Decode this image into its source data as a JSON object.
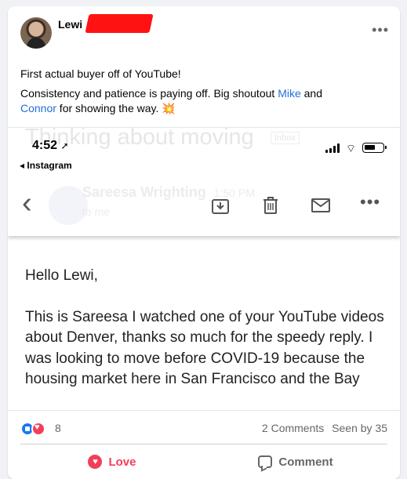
{
  "post": {
    "author": "Lewi",
    "text_line1": "First actual buyer off of YouTube!",
    "text_line2a": "Consistency and patience is paying off.   Big shoutout ",
    "mention1": "Mike",
    "text_and": " and",
    "mention2": "Connor",
    "text_line3": " for showing the way. ",
    "emoji": "💥"
  },
  "screenshot": {
    "ghost_subject": "Thinking about moving",
    "ghost_inbox": "Inbox",
    "time": "4:52",
    "time_arrow": "➚",
    "back_app": "◂ Instagram",
    "ghost_sender": "Sareesa Wrighting",
    "ghost_time": "1:50 PM",
    "ghost_to": "to me",
    "email_greeting": "Hello Lewi,",
    "email_body": "This is Sareesa I watched one of your YouTube videos about Denver, thanks so much for the speedy reply. I was looking to move before COVID-19 because the housing market here in San Francisco and the Bay"
  },
  "reactions": {
    "count": "8",
    "comments": "2 Comments",
    "seen": "Seen by 35"
  },
  "actions": {
    "love": "Love",
    "comment": "Comment"
  },
  "colors": {
    "link": "#216fdb",
    "love": "#f33e58",
    "like": "#1877f2",
    "redaction": "#ff1212"
  }
}
